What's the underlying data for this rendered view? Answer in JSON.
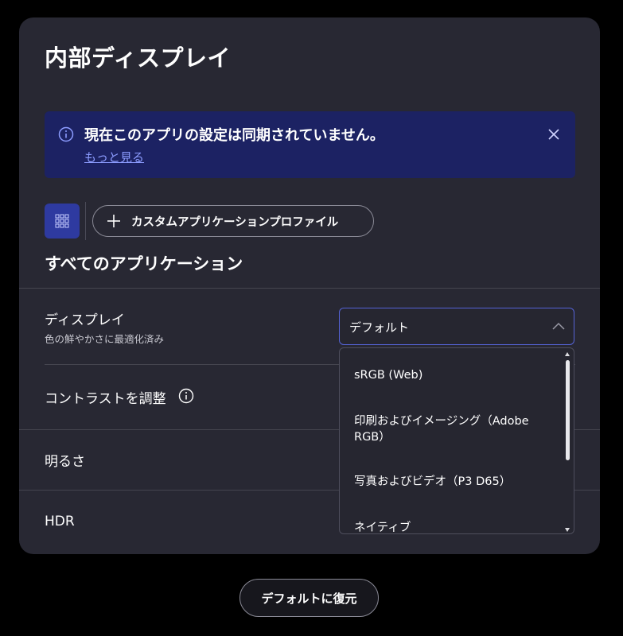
{
  "header": {
    "title": "内部ディスプレイ"
  },
  "banner": {
    "message": "現在このアプリの設定は同期されていません。",
    "link": "もっと見る",
    "icon": "info-icon",
    "close_icon": "close-icon",
    "background": "#1c2263"
  },
  "profiles": {
    "grid_icon": "apps-grid-icon",
    "add_label": "カスタムアプリケーションプロファイル",
    "add_icon": "plus-icon"
  },
  "section": {
    "title": "すべてのアプリケーション"
  },
  "settings": {
    "display": {
      "label": "ディスプレイ",
      "sub": "色の鮮やかさに最適化済み"
    },
    "contrast": {
      "label": "コントラストを調整",
      "icon": "info-icon"
    },
    "brightness": {
      "label": "明るさ"
    },
    "hdr": {
      "label": "HDR"
    }
  },
  "select": {
    "value": "デフォルト",
    "options": [
      "sRGB (Web)",
      "印刷およびイメージング（Adobe RGB）",
      "写真およびビデオ（P3 D65）",
      "ネイティブ"
    ],
    "accent": "#5563d6"
  },
  "footer": {
    "restore_label": "デフォルトに復元"
  }
}
